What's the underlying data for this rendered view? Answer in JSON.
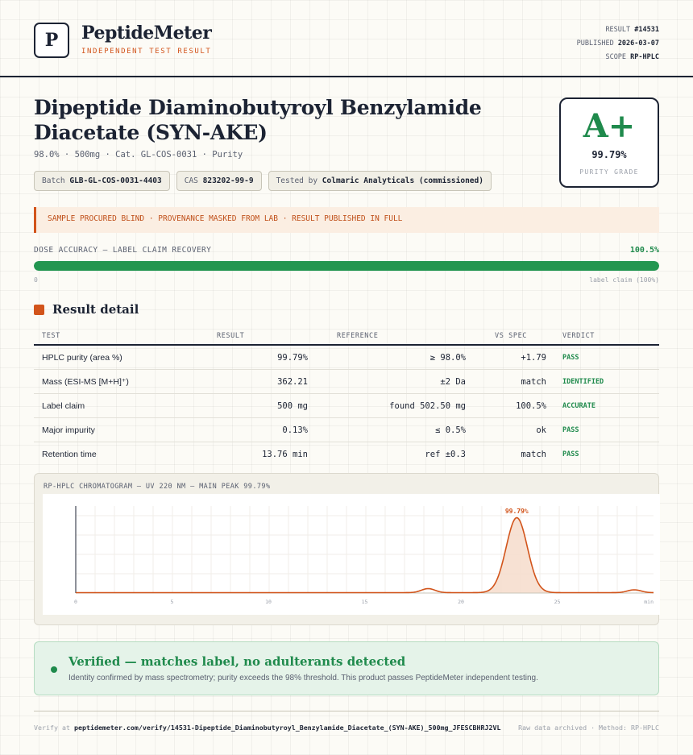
{
  "header": {
    "logo_letter": "P",
    "brand": "PeptideMeter",
    "tagline": "INDEPENDENT TEST RESULT",
    "meta": {
      "result_label": "RESULT",
      "result_value": "#14531",
      "published_label": "PUBLISHED",
      "published_value": "2026-03-07",
      "scope_label": "SCOPE",
      "scope_value": "RP-HPLC"
    }
  },
  "product": {
    "title": "Dipeptide Diaminobutyroyl Benzylamide Diacetate (SYN-AKE)",
    "subline": "98.0% · 500mg · Cat. GL-COS-0031 · Purity",
    "chips": [
      {
        "label": "Batch",
        "value": "GLB-GL-COS-0031-4403"
      },
      {
        "label": "CAS",
        "value": "823202-99-9"
      },
      {
        "label": "Tested by",
        "value": "Colmaric Analyticals (commissioned)"
      }
    ]
  },
  "grade": {
    "letter": "A+",
    "value": "99.79%",
    "label": "PURITY GRADE"
  },
  "notice": "SAMPLE PROCURED BLIND · PROVENANCE MASKED FROM LAB · RESULT PUBLISHED IN FULL",
  "dose": {
    "label": "DOSE ACCURACY — LABEL CLAIM RECOVERY",
    "value": "100.5%",
    "fill_fraction": 1.0,
    "min_label": "0",
    "max_label": "label claim (100%)"
  },
  "section_title": "Result detail",
  "table": {
    "headers": [
      "TEST",
      "RESULT",
      "REFERENCE",
      "VS SPEC",
      "VERDICT"
    ],
    "rows": [
      {
        "test": "HPLC purity (area %)",
        "result": "99.79%",
        "reference": "≥ 98.0%",
        "vs_spec": "+1.79",
        "verdict": "PASS"
      },
      {
        "test": "Mass (ESI-MS [M+H]⁺)",
        "result": "362.21",
        "reference": "±2 Da",
        "vs_spec": "match",
        "verdict": "IDENTIFIED"
      },
      {
        "test": "Label claim",
        "result": "500 mg",
        "reference": "found 502.50 mg",
        "vs_spec": "100.5%",
        "verdict": "ACCURATE"
      },
      {
        "test": "Major impurity",
        "result": "0.13%",
        "reference": "≤ 0.5%",
        "vs_spec": "ok",
        "verdict": "PASS"
      },
      {
        "test": "Retention time",
        "result": "13.76 min",
        "reference": "ref ±0.3",
        "vs_spec": "match",
        "verdict": "PASS"
      }
    ]
  },
  "chart_data": {
    "type": "line",
    "title": "RP-HPLC CHROMATOGRAM — UV 220 NM — MAIN PEAK 99.79%",
    "xlabel": "",
    "ylabel": "",
    "x_ticks": [
      0,
      5,
      10,
      15,
      20,
      25
    ],
    "x_end_label": "min",
    "xlim": [
      0,
      30
    ],
    "ylim": [
      0,
      1.08
    ],
    "baseline": 0.0,
    "peaks": [
      {
        "center": 18.3,
        "height": 0.05,
        "width": 0.35
      },
      {
        "center": 22.9,
        "height": 0.93,
        "width": 0.55,
        "label": "99.79%"
      },
      {
        "center": 29.0,
        "height": 0.035,
        "width": 0.35
      }
    ],
    "line_color": "#d2541b",
    "fill_color": "#f6dccb"
  },
  "verified": {
    "title": "Verified — matches label, no adulterants detected",
    "description": "Identity confirmed by mass spectrometry; purity exceeds the 98% threshold. This product passes PeptideMeter independent testing."
  },
  "footer": {
    "verify_prefix": "Verify at",
    "url": "peptidemeter.com/verify/14531-Dipeptide_Diaminobutyroyl_Benzylamide_Diacetate_(SYN-AKE)_500mg_JFESCBHRJ2VL",
    "right_text": "Raw data archived · Method: RP-HPLC"
  }
}
